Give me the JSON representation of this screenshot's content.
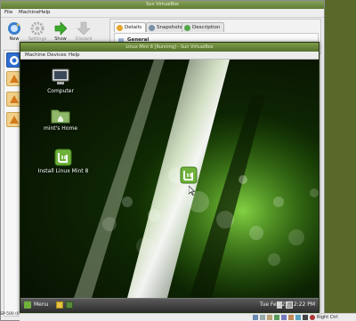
{
  "manager": {
    "title": "Sun VirtualBox",
    "menu": [
      "File",
      "Machine",
      "Help"
    ],
    "toolbar": [
      {
        "label": "New",
        "icon": "new-vm-icon",
        "enabled": true
      },
      {
        "label": "Settings",
        "icon": "settings-gear-icon",
        "enabled": false
      },
      {
        "label": "Show",
        "icon": "show-arrow-icon",
        "enabled": true
      },
      {
        "label": "Discard",
        "icon": "discard-arrow-icon",
        "enabled": false
      }
    ],
    "tabs": [
      {
        "label": "Details",
        "icon": "details-icon",
        "active": true
      },
      {
        "label": "Snapshots",
        "icon": "snapshots-icon",
        "active": false
      },
      {
        "label": "Description",
        "icon": "description-icon",
        "active": false
      }
    ],
    "section": "General",
    "side_text": "SP-500 (6v"
  },
  "guest": {
    "title": "Linux Mint 8 [Running] - Sun VirtualBox",
    "menu": [
      "Machine",
      "Devices",
      "Help"
    ],
    "desktop_icons": [
      {
        "label": "Computer",
        "icon": "computer-icon"
      },
      {
        "label": "mint's Home",
        "icon": "home-folder-icon"
      },
      {
        "label": "Install Linux Mint 8",
        "icon": "mint-install-icon"
      }
    ],
    "panel": {
      "menu_label": "Menu",
      "clock": "Tue Feb 23,  2:22 PM"
    }
  },
  "statusbar": {
    "host_key": "Right Ctrl"
  },
  "colors": {
    "mint_green": "#6fb13a",
    "title_green": "#5f7c32",
    "host_background": "#59692a"
  }
}
